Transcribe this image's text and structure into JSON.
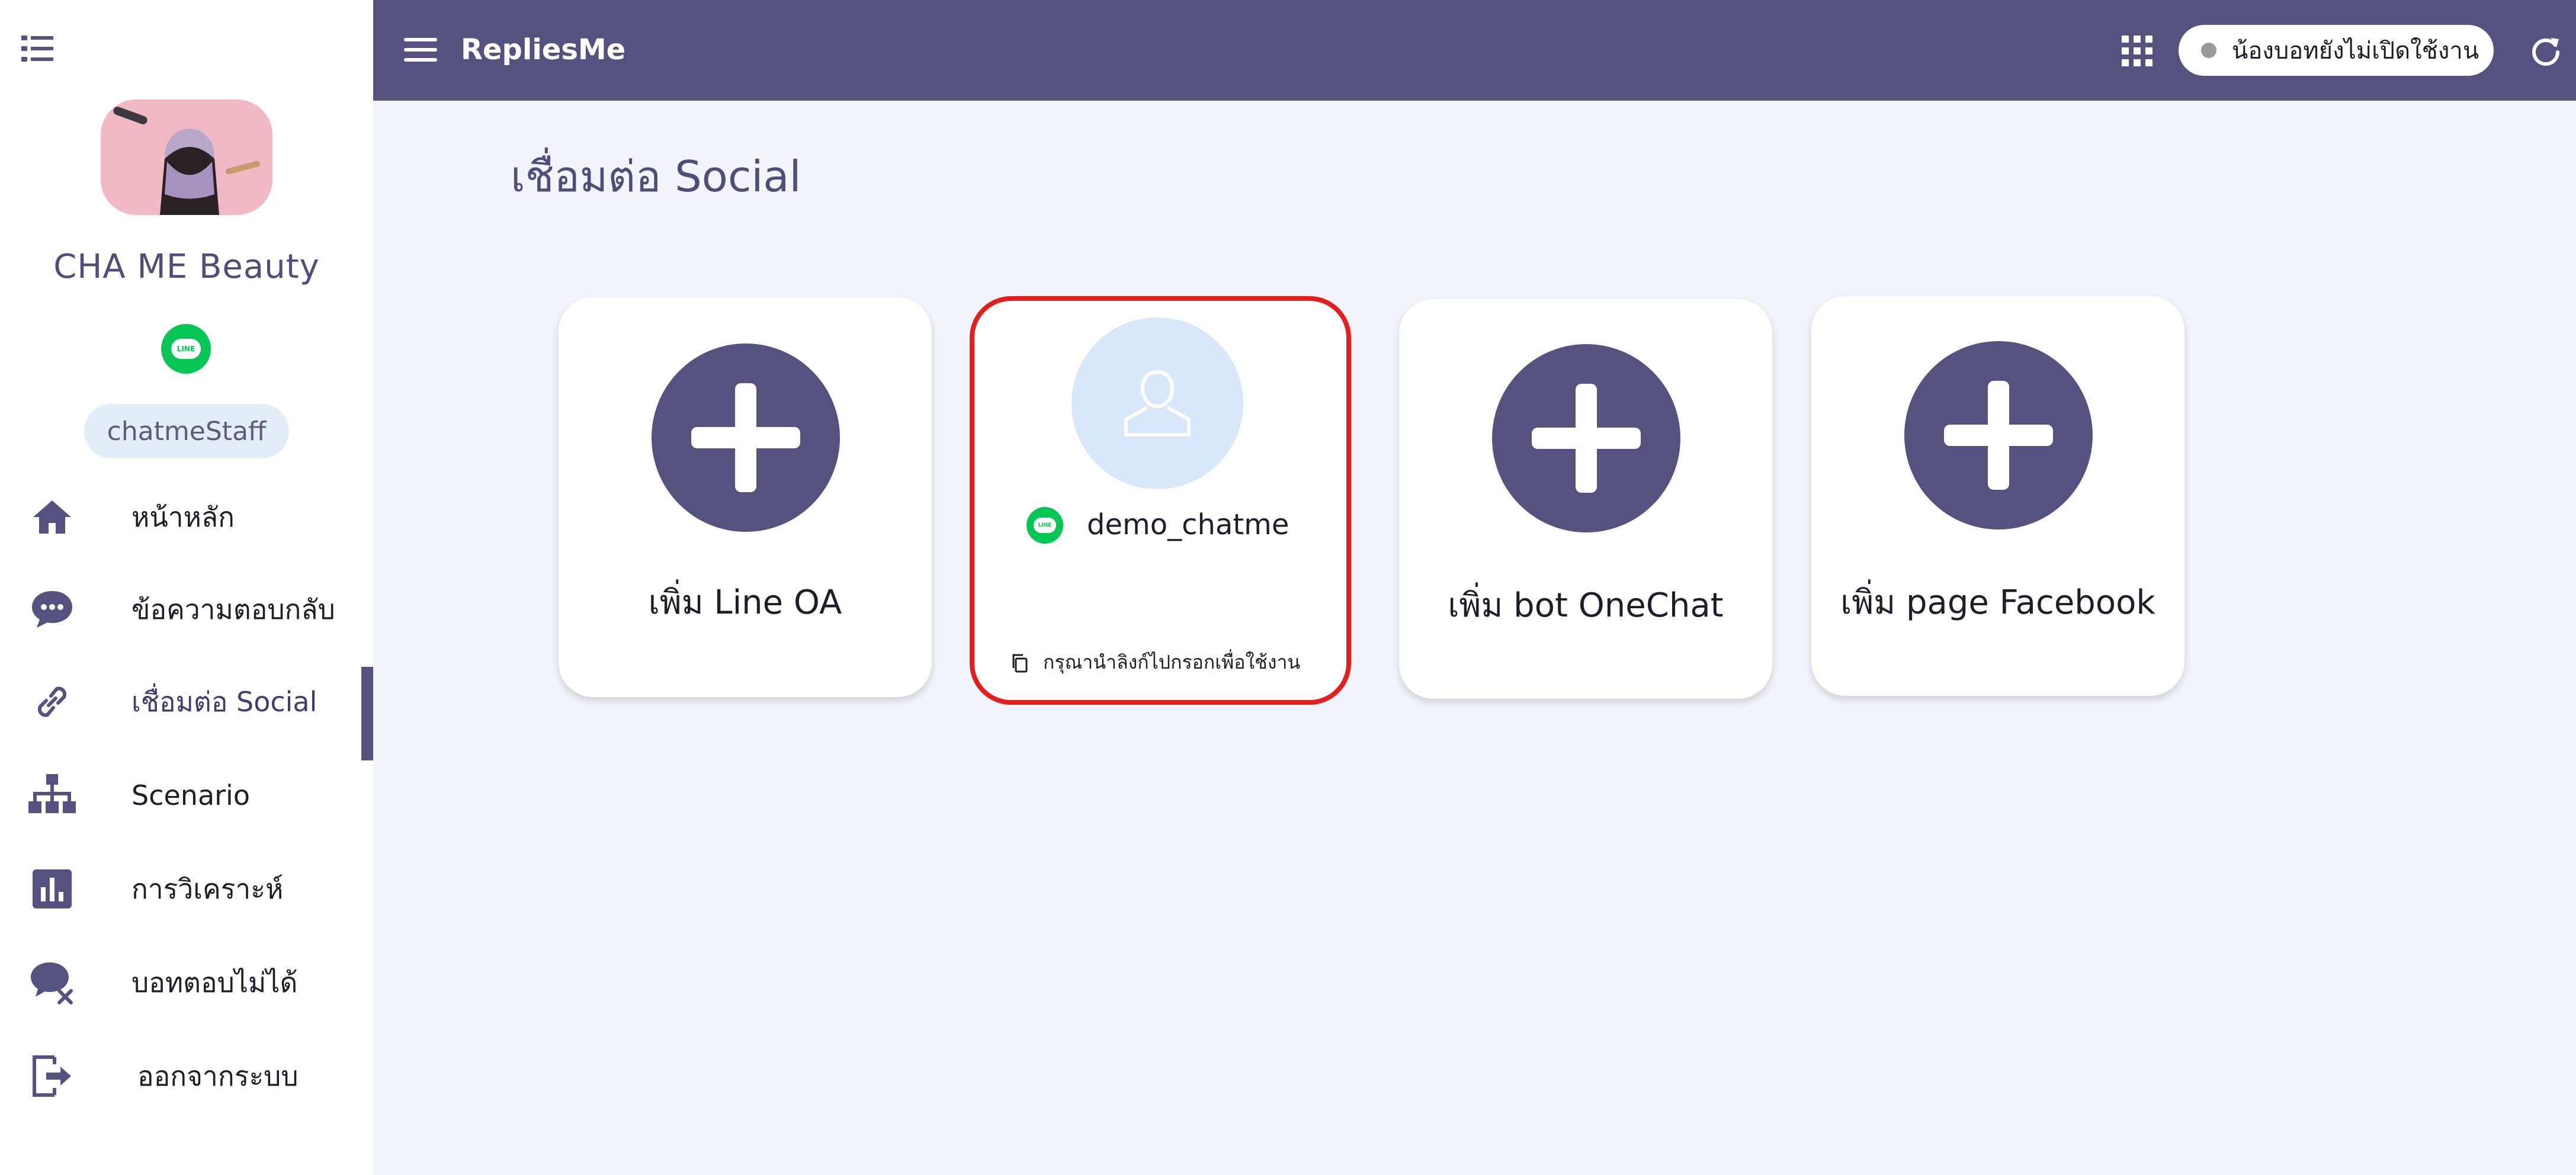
{
  "header": {
    "brand": "RepliesMe",
    "status": "น้องบอทยังไม่เปิดใช้งาน"
  },
  "sidebar": {
    "shop_name": "CHA ME Beauty",
    "line_badge": "LINE",
    "role": "chatmeStaff",
    "items": [
      {
        "label": "หน้าหลัก",
        "icon": "home-icon"
      },
      {
        "label": "ข้อความตอบกลับ",
        "icon": "chat-bubble-icon"
      },
      {
        "label": "เชื่อมต่อ Social",
        "icon": "link-icon",
        "active": true
      },
      {
        "label": "Scenario",
        "icon": "sitemap-icon"
      },
      {
        "label": "การวิเคราะห์",
        "icon": "bar-chart-icon"
      },
      {
        "label": "บอทตอบไม่ได้",
        "icon": "chat-cross-icon"
      },
      {
        "label": "ออกจากระบบ",
        "icon": "logout-icon"
      }
    ]
  },
  "main": {
    "title": "เชื่อมต่อ Social",
    "cards": [
      {
        "label": "เพิ่ม Line OA"
      },
      {
        "label": "เพิ่ม bot OneChat"
      },
      {
        "label": "เพิ่ม page Facebook"
      }
    ],
    "account": {
      "name": "demo_chatme",
      "line_badge": "LINE",
      "copy_hint": "กรุณานำลิงก์ไปกรอกเพื่อใช้งาน"
    }
  },
  "colors": {
    "primary": "#55527f",
    "background": "#f4f5fc",
    "line_green": "#06c755",
    "highlight_red": "#e41d1d"
  }
}
